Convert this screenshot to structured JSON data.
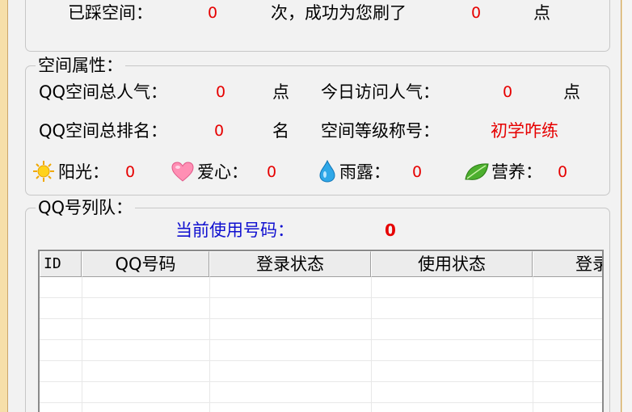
{
  "top": {
    "visited_label": "已踩空间：",
    "visited_count": "0",
    "success_label": "次，成功为您刷了",
    "success_count": "0",
    "unit": "点"
  },
  "props": {
    "legend": "空间属性：",
    "popularity_label": "QQ空间总人气：",
    "popularity_value": "0",
    "popularity_unit": "点",
    "today_label": "今日访问人气：",
    "today_value": "0",
    "today_unit": "点",
    "rank_label": "QQ空间总排名：",
    "rank_value": "0",
    "rank_unit": "名",
    "level_label": "空间等级称号：",
    "level_value": "初学咋练",
    "sunshine_label": "阳光：",
    "sunshine_value": "0",
    "love_label": "爱心：",
    "love_value": "0",
    "rain_label": "雨露：",
    "rain_value": "0",
    "nutrition_label": "营养：",
    "nutrition_value": "0",
    "icons": [
      "sun-icon",
      "heart-icon",
      "raindrop-icon",
      "leaf-icon"
    ]
  },
  "queue": {
    "legend": "QQ号列队：",
    "current_label": "当前使用号码：",
    "current_value": "0",
    "columns": [
      "ID",
      "QQ号码",
      "登录状态",
      "使用状态",
      "登录"
    ]
  },
  "colors": {
    "value_red": "#e60000",
    "label_blue": "#1010d0",
    "frame": "#f6dfa9"
  }
}
